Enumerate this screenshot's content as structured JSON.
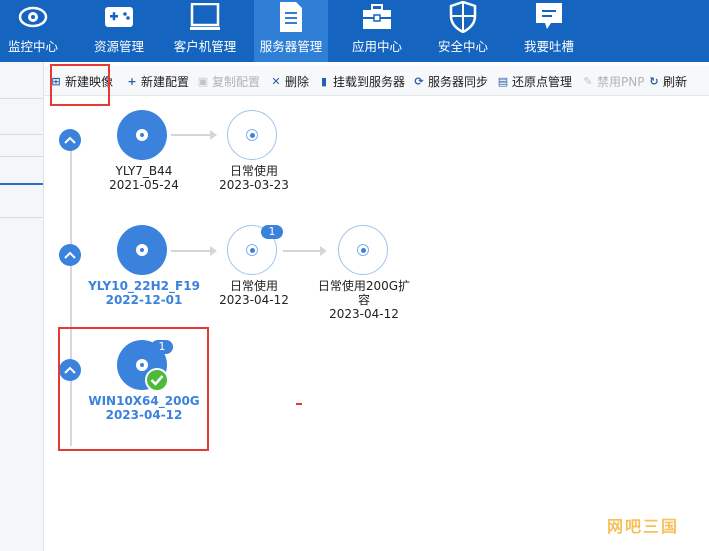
{
  "nav": {
    "items": [
      {
        "label": "监控中心",
        "icon": "eye-icon"
      },
      {
        "label": "资源管理",
        "icon": "gamepad-icon"
      },
      {
        "label": "客户机管理",
        "icon": "monitor-icon"
      },
      {
        "label": "服务器管理",
        "icon": "server-icon"
      },
      {
        "label": "应用中心",
        "icon": "toolbox-icon"
      },
      {
        "label": "安全中心",
        "icon": "shield-icon"
      },
      {
        "label": "我要吐槽",
        "icon": "chat-icon"
      }
    ],
    "active_index": 3
  },
  "toolbar": {
    "new_image": "新建映像",
    "new_config": "新建配置",
    "copy_config": "复制配置",
    "delete": "删除",
    "mount": "挂载到服务器",
    "sync": "服务器同步",
    "restore": "还原点管理",
    "disable_pnp": "禁用PNP",
    "refresh": "刷新"
  },
  "images": {
    "row1": {
      "base": {
        "name": "YLY7_B44",
        "date": "2021-05-24"
      },
      "configs": [
        {
          "name": "日常使用",
          "date": "2023-03-23"
        }
      ]
    },
    "row2": {
      "base": {
        "name": "YLY10_22H2_F19",
        "date": "2022-12-01"
      },
      "configs": [
        {
          "name": "日常使用",
          "date": "2023-04-12",
          "badge": "1"
        },
        {
          "name": "日常使用200G扩容",
          "date": "2023-04-12"
        }
      ]
    },
    "row3": {
      "base": {
        "name": "WIN10X64_200G",
        "date": "2023-04-12",
        "badge": "1"
      }
    }
  },
  "colors": {
    "nav_bg": "#1565c0",
    "nav_active": "#2f7fd6",
    "accent": "#3a82dc",
    "highlight": "#e53935",
    "success": "#4cbb3b"
  },
  "watermark": "网吧三国"
}
